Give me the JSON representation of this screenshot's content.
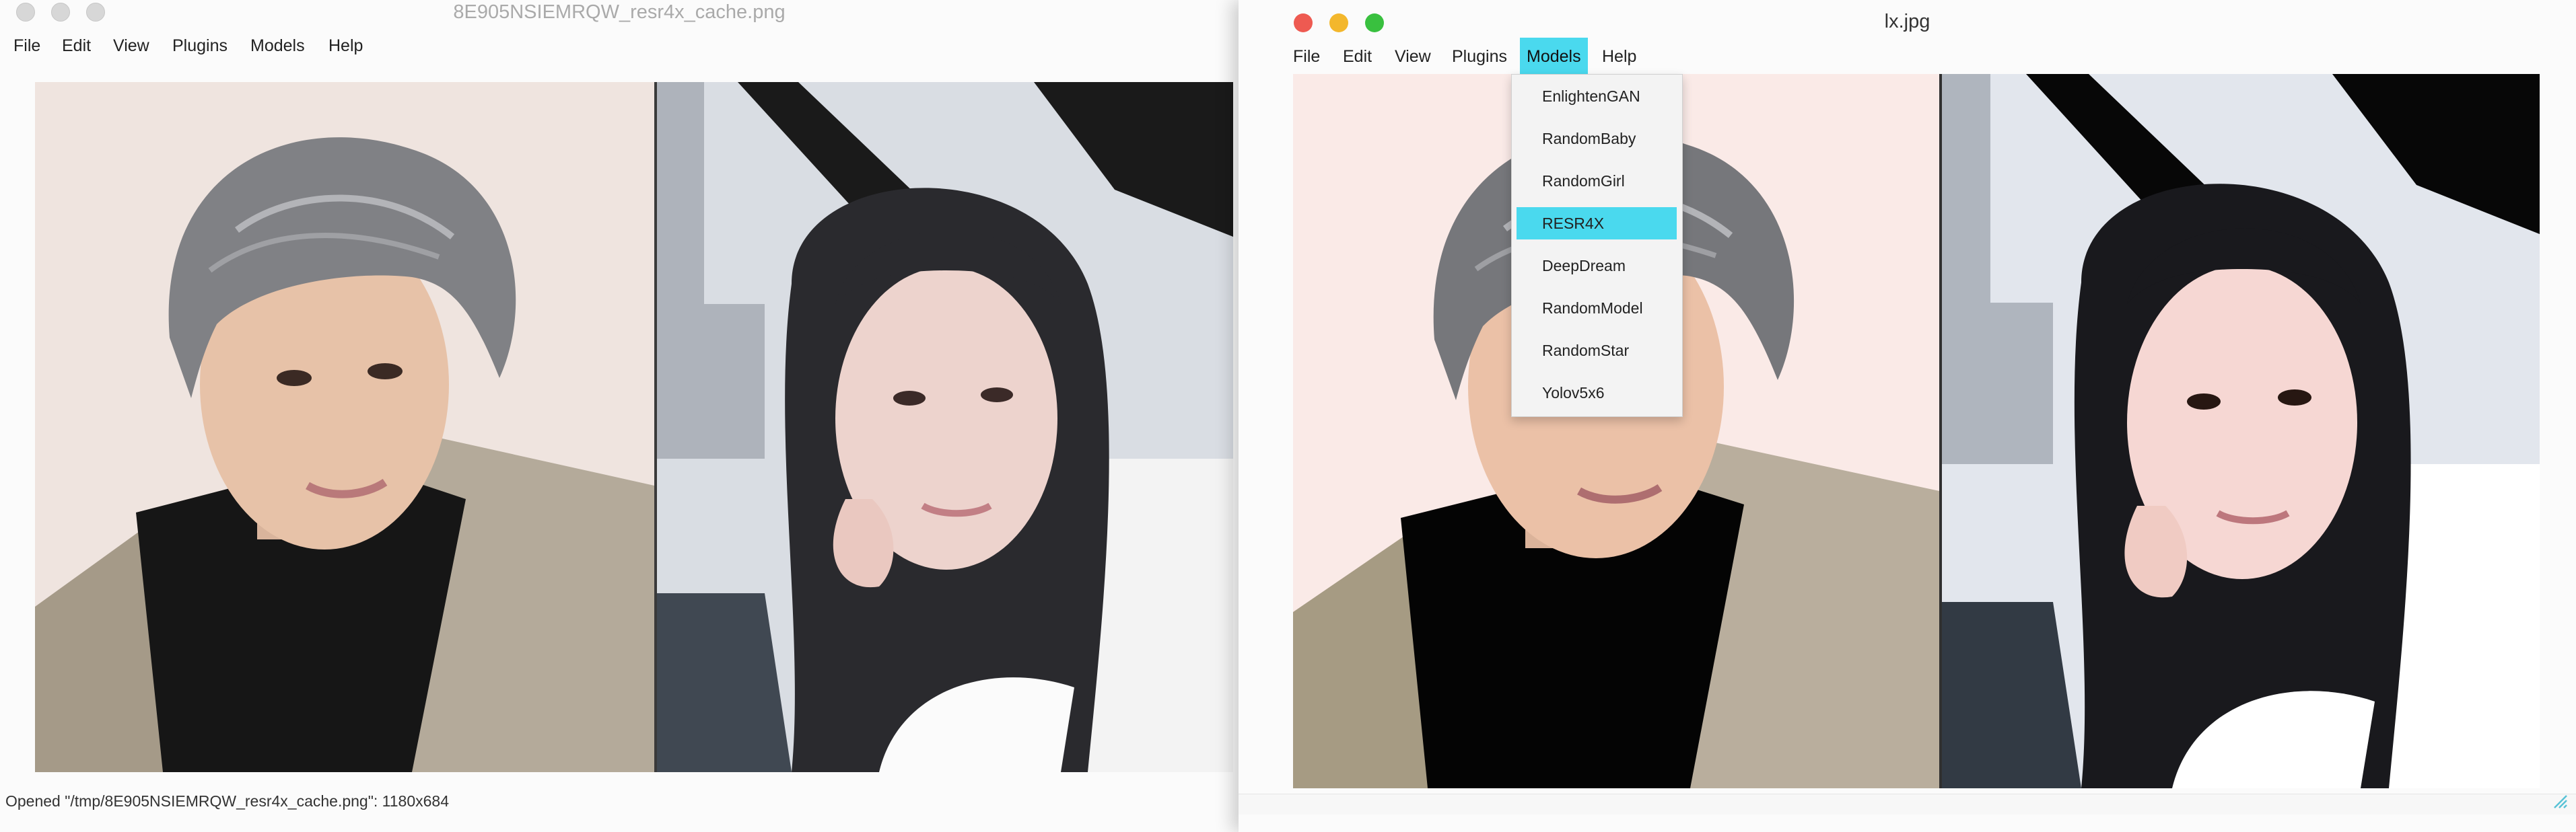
{
  "left_window": {
    "title": "8E905NSIEMRQW_resr4x_cache.png",
    "menu": [
      "File",
      "Edit",
      "View",
      "Plugins",
      "Models",
      "Help"
    ],
    "status": "Opened \"/tmp/8E905NSIEMRQW_resr4x_cache.png\": 1180x684"
  },
  "right_window": {
    "title": "lx.jpg",
    "menu": [
      "File",
      "Edit",
      "View",
      "Plugins",
      "Models",
      "Help"
    ],
    "active_menu": "Models",
    "models_dropdown": {
      "items": [
        "EnlightenGAN",
        "RandomBaby",
        "RandomGirl",
        "RESR4X",
        "DeepDream",
        "RandomModel",
        "RandomStar",
        "Yolov5x6"
      ],
      "selected": "RESR4X"
    }
  },
  "colors": {
    "menu_highlight": "#4ad9ee",
    "close": "#ee5a51",
    "minimize": "#f3b72c",
    "zoom": "#39c03f"
  },
  "icons": {
    "resize_grip": "resize-grip-icon"
  }
}
